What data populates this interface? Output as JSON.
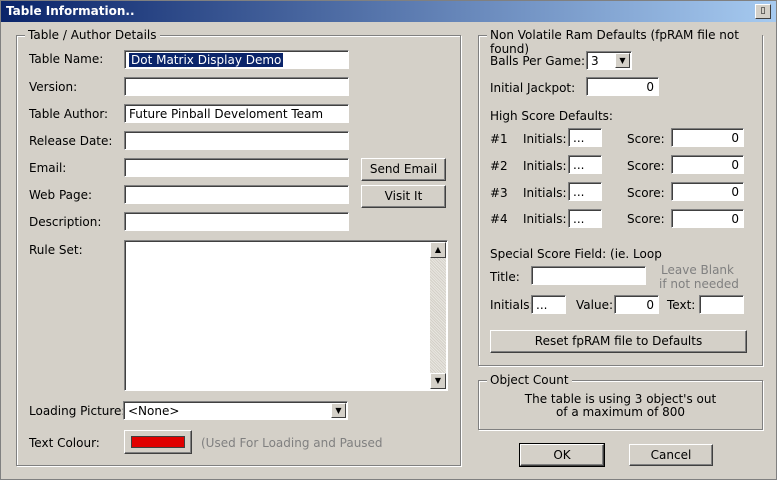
{
  "window": {
    "title": "Table Information..",
    "close_glyph": "▯"
  },
  "table_author": {
    "legend": "Table / Author Details",
    "table_name_label": "Table Name:",
    "table_name_value": "Dot Matrix Display Demo",
    "version_label": "Version:",
    "version_value": "",
    "author_label": "Table Author:",
    "author_value": "Future Pinball Develoment Team",
    "release_date_label": "Release Date:",
    "release_date_value": "",
    "email_label": "Email:",
    "email_value": "",
    "send_email_label": "Send Email",
    "web_page_label": "Web Page:",
    "web_page_value": "",
    "visit_it_label": "Visit It",
    "description_label": "Description:",
    "description_value": "",
    "rule_set_label": "Rule Set:",
    "rule_set_value": "",
    "loading_picture_label": "Loading Picture:",
    "loading_picture_value": "<None>",
    "text_colour_label": "Text Colour:",
    "text_colour_value": "#e00000",
    "text_colour_note": "(Used For Loading and Paused"
  },
  "nvram": {
    "legend": "Non Volatile Ram Defaults (fpRAM file not found)",
    "balls_label": "Balls Per Game:",
    "balls_value": "3",
    "jackpot_label": "Initial Jackpot:",
    "jackpot_value": "0",
    "high_score_label": "High Score Defaults:",
    "initials_label": "Initials:",
    "score_label": "Score:",
    "rows": [
      {
        "rank": "#1",
        "initials": "...",
        "score": "0"
      },
      {
        "rank": "#2",
        "initials": "...",
        "score": "0"
      },
      {
        "rank": "#3",
        "initials": "...",
        "score": "0"
      },
      {
        "rank": "#4",
        "initials": "...",
        "score": "0"
      }
    ],
    "special_label": "Special Score Field: (ie. Loop",
    "title_label": "Title:",
    "title_value": "",
    "leave_blank_1": "Leave Blank",
    "leave_blank_2": "if not needed",
    "special_initials_label": "Initials:",
    "special_initials_value": "...",
    "value_label": "Value:",
    "value_value": "0",
    "text_label": "Text:",
    "text_value": "",
    "reset_label": "Reset fpRAM file to Defaults"
  },
  "object_count": {
    "legend": "Object Count",
    "line1": "The table is using 3 object's out",
    "line2": "of a maximum of 800"
  },
  "buttons": {
    "ok": "OK",
    "cancel": "Cancel"
  }
}
